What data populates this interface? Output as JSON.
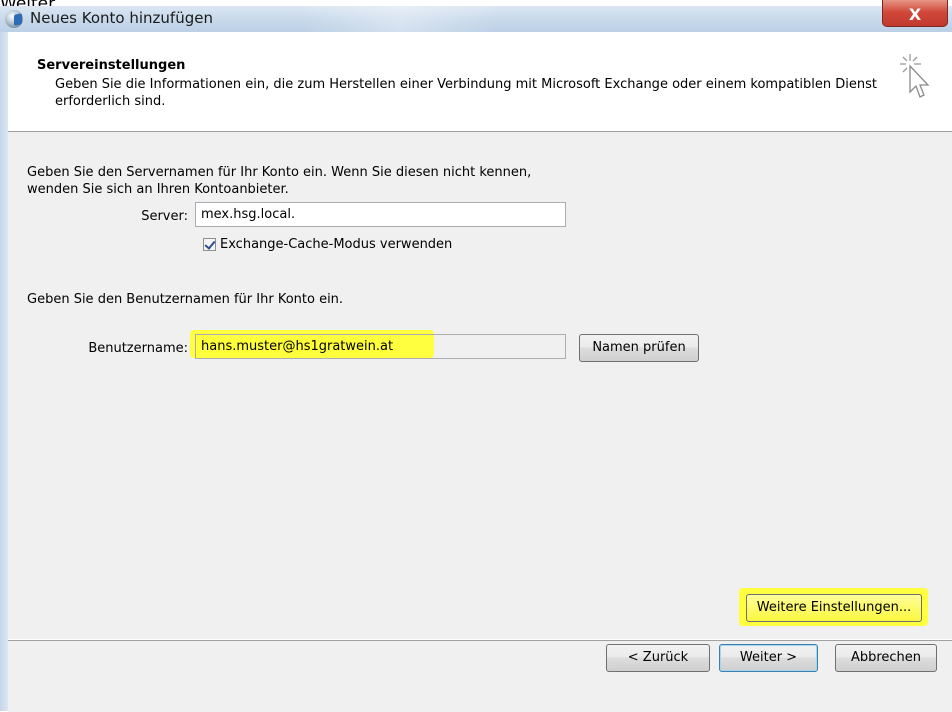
{
  "background_text": "Weiter",
  "window": {
    "title": "Neues Konto hinzufügen",
    "close_label": "X"
  },
  "header": {
    "title": "Servereinstellungen",
    "description": "Geben Sie die Informationen ein, die zum Herstellen einer Verbindung mit Microsoft Exchange oder einem kompatiblen Dienst erforderlich sind."
  },
  "server_section": {
    "instruction_line1": "Geben Sie den Servernamen für Ihr Konto ein. Wenn Sie diesen nicht kennen,",
    "instruction_line2": "wenden Sie sich an Ihren Kontoanbieter.",
    "server_label": "Server:",
    "server_value": "mex.hsg.local.",
    "cache_checkbox_label": "Exchange-Cache-Modus verwenden",
    "cache_checked": true
  },
  "user_section": {
    "instruction": "Geben Sie den Benutzernamen für Ihr Konto ein.",
    "username_label": "Benutzername:",
    "username_value": "hans.muster@hs1gratwein.at",
    "check_names_button": "Namen prüfen"
  },
  "more_settings_button": "Weitere Einstellungen...",
  "footer": {
    "back_button": "< Zurück",
    "next_button": "Weiter >",
    "cancel_button": "Abbrechen"
  },
  "colors": {
    "highlight": "#ffff3a",
    "title_bar": "#c7d8ea",
    "dialog_bg": "#f0f0f0"
  }
}
